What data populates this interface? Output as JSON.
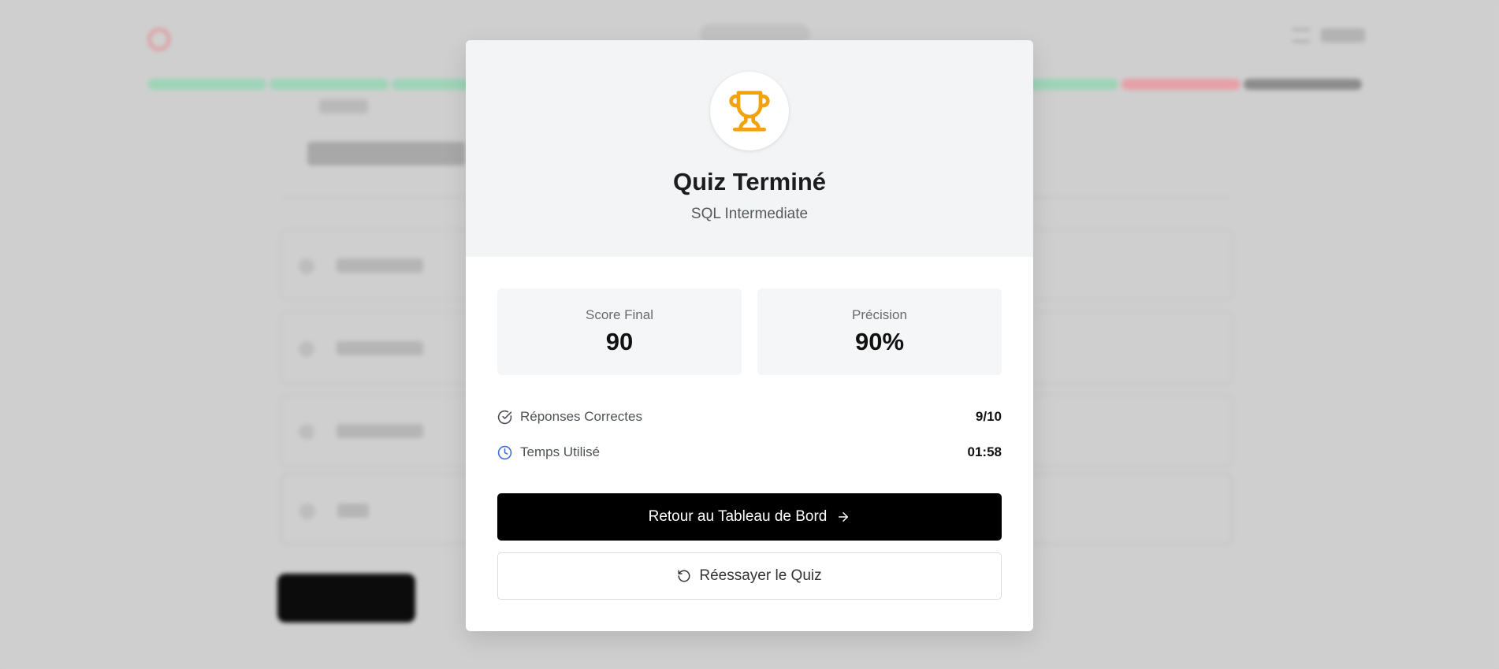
{
  "modal": {
    "title": "Quiz Terminé",
    "subtitle": "SQL Intermediate",
    "trophy_icon": "trophy-icon",
    "stats": [
      {
        "label": "Score Final",
        "value": "90"
      },
      {
        "label": "Précision",
        "value": "90%"
      }
    ],
    "details": [
      {
        "icon": "check-circle-icon",
        "label": "Réponses Correctes",
        "value": "9/10"
      },
      {
        "icon": "clock-icon",
        "label": "Temps Utilisé",
        "value": "01:58"
      }
    ],
    "primary_button": {
      "label": "Retour au Tableau de Bord",
      "icon": "arrow-right-icon"
    },
    "secondary_button": {
      "label": "Réessayer le Quiz",
      "icon": "retry-icon"
    }
  },
  "colors": {
    "trophy": "#f2a20c",
    "primary_button_bg": "#000000",
    "clock_icon": "#3b6fd9",
    "progress_correct": "#9ed4b8",
    "progress_wrong": "#e7a0a6",
    "progress_pending": "#8c8c8c"
  }
}
